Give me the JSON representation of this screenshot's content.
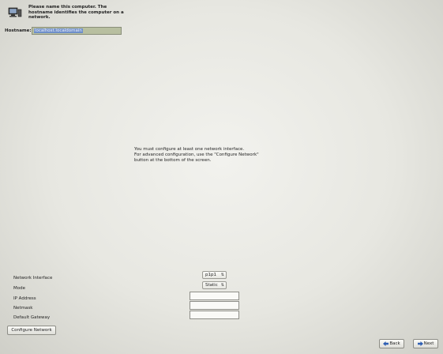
{
  "header": {
    "icon": "network-computer-icon",
    "text": "Please name this computer.  The hostname identifies the computer on a network."
  },
  "hostname": {
    "label": "Hostname:",
    "value": "localhost.localdomain"
  },
  "message": {
    "line1": "You must configure at least one network interface.",
    "line2": "For advanced configuration, use the \"Configure Network\" button at the bottom of the screen."
  },
  "form": {
    "interface_label": "Network Interface",
    "interface_value": "p1p1",
    "mode_label": "Mode",
    "mode_value": "Static",
    "ip_label": "IP Address",
    "ip_value": "",
    "netmask_label": "Netmask",
    "netmask_value": "",
    "gateway_label": "Default Gateway",
    "gateway_value": ""
  },
  "buttons": {
    "configure_network": "Configure Network",
    "back": "Back",
    "next": "Next"
  },
  "colors": {
    "hostname_highlight": "#6f8fc9",
    "back_icon": "#2f5fb3",
    "next_icon": "#2f5fb3"
  }
}
